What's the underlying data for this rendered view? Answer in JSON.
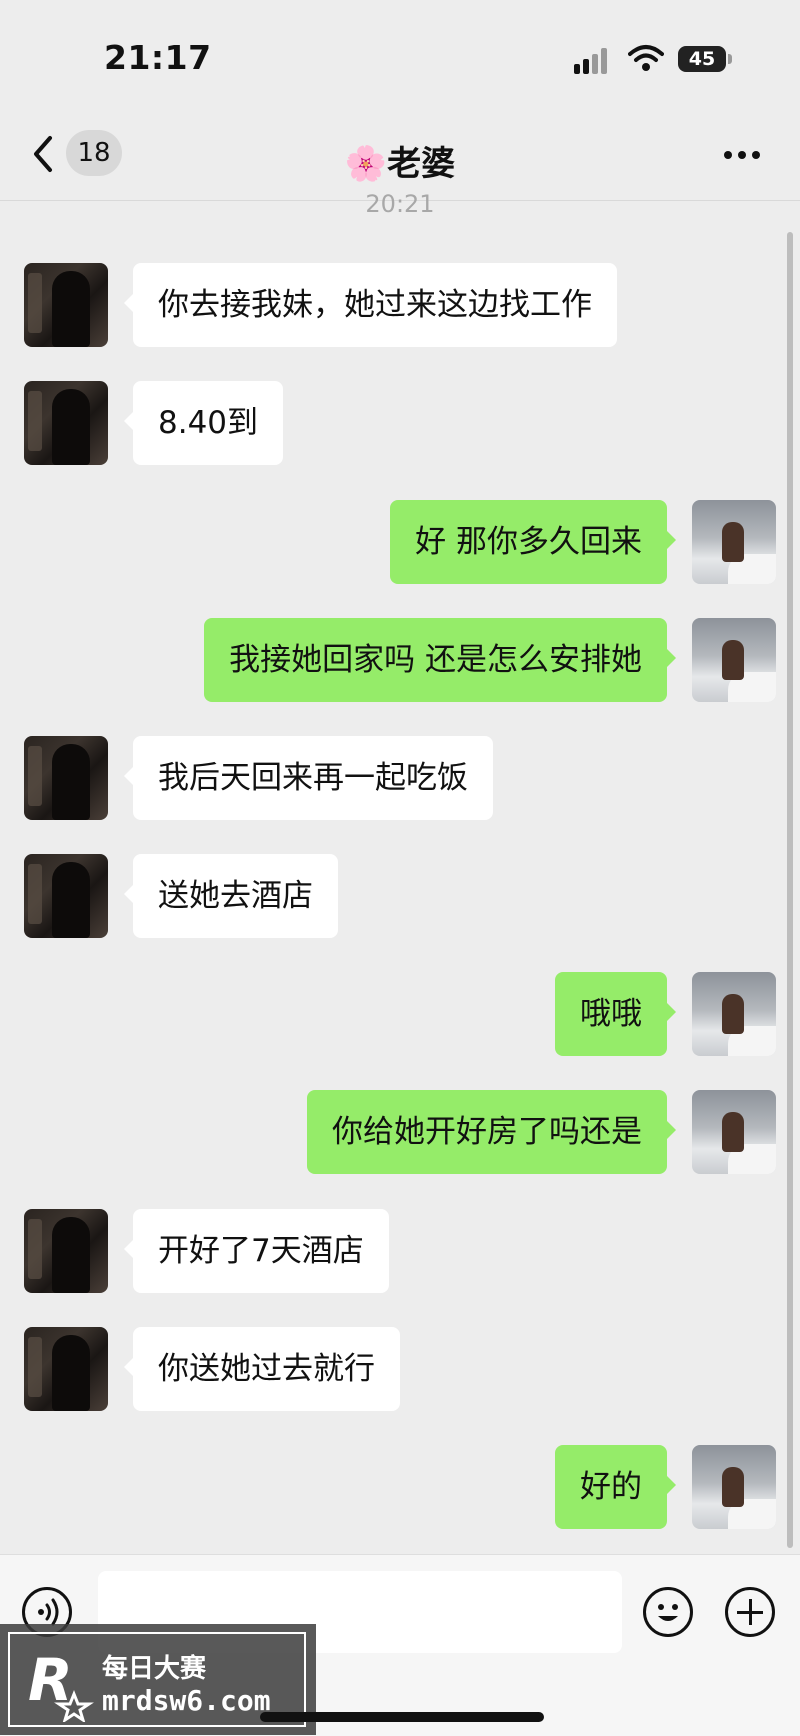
{
  "status_bar": {
    "time": "21:17",
    "battery": "45"
  },
  "nav": {
    "unread_count": "18",
    "title": "🌸老婆"
  },
  "chat": {
    "timestamp": "20:21",
    "messages": [
      {
        "sender": "her",
        "text": "你去接我妹，她过来这边找工作"
      },
      {
        "sender": "her",
        "text": "8.40到"
      },
      {
        "sender": "me",
        "text": "好 那你多久回来"
      },
      {
        "sender": "me",
        "text": "我接她回家吗 还是怎么安排她"
      },
      {
        "sender": "her",
        "text": "我后天回来再一起吃饭"
      },
      {
        "sender": "her",
        "text": "送她去酒店"
      },
      {
        "sender": "me",
        "text": "哦哦"
      },
      {
        "sender": "me",
        "text": "你给她开好房了吗还是"
      },
      {
        "sender": "her",
        "text": "开好了7天酒店"
      },
      {
        "sender": "her",
        "text": "你送她过去就行"
      },
      {
        "sender": "me",
        "text": "好的"
      }
    ]
  },
  "colors": {
    "sent_bubble": "#95ec69",
    "received_bubble": "#ffffff",
    "background": "#ededed"
  },
  "icons": {
    "back": "chevron-left-icon",
    "more": "more-dots-icon",
    "voice": "voice-icon",
    "emoji": "emoji-icon",
    "plus": "plus-icon"
  },
  "watermark": {
    "title": "每日大赛",
    "url": "mrdsw6.com"
  }
}
